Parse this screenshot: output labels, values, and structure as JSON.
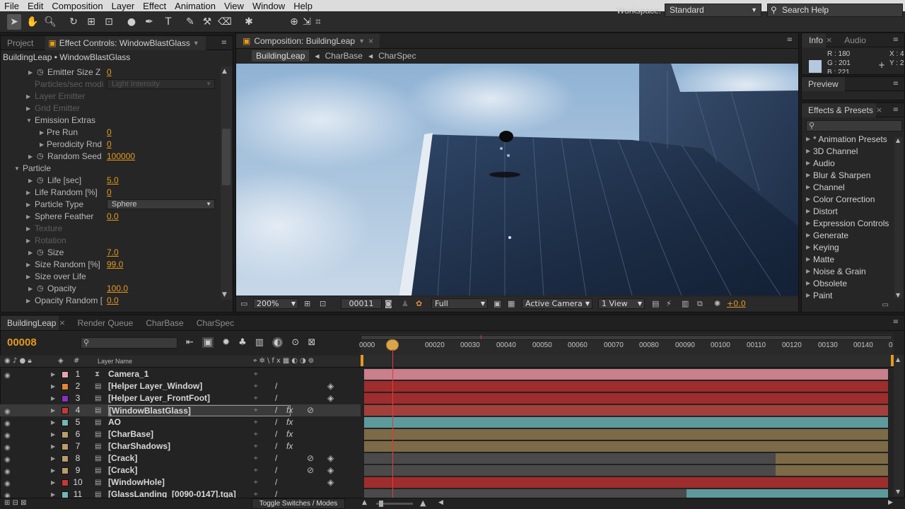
{
  "menu": [
    "File",
    "Edit",
    "Composition",
    "Layer",
    "Effect",
    "Animation",
    "View",
    "Window",
    "Help"
  ],
  "workspace": {
    "label": "Workspace:",
    "value": "Standard"
  },
  "search_help": "Search Help",
  "left_panel": {
    "tab_project": "Project",
    "tab_effect": "Effect Controls: WindowBlastGlass",
    "title": "BuildingLeap • WindowBlastGlass",
    "props": [
      {
        "name": "Emitter Size Z",
        "val": "0",
        "indent": 2,
        "stopwatch": true
      },
      {
        "name": "Particles/sec modi",
        "dd": "Light Intensity",
        "indent": 2,
        "dim": true
      },
      {
        "name": "Layer Emitter",
        "indent": 1,
        "dim": true
      },
      {
        "name": "Grid Emitter",
        "indent": 1,
        "dim": true
      },
      {
        "name": "Emission Extras",
        "indent": 1,
        "open": true
      },
      {
        "name": "Pre Run",
        "val": "0",
        "indent": 2
      },
      {
        "name": "Perodicity Rnd",
        "val": "0",
        "indent": 2
      },
      {
        "name": "Random Seed",
        "val": "100000",
        "indent": 2,
        "stopwatch": true
      },
      {
        "name": "Particle",
        "indent": 0,
        "open": true
      },
      {
        "name": "Life [sec]",
        "val": "5.0",
        "indent": 2,
        "stopwatch": true
      },
      {
        "name": "Life Random [%]",
        "val": "0",
        "indent": 1
      },
      {
        "name": "Particle Type",
        "dd": "Sphere",
        "indent": 1
      },
      {
        "name": "Sphere Feather",
        "val": "0.0",
        "indent": 1
      },
      {
        "name": "Texture",
        "indent": 1,
        "dim": true
      },
      {
        "name": "Rotation",
        "indent": 1,
        "dim": true
      },
      {
        "name": "Size",
        "val": "7.0",
        "indent": 2,
        "stopwatch": true
      },
      {
        "name": "Size Random [%]",
        "val": "99.0",
        "indent": 1
      },
      {
        "name": "Size over Life",
        "indent": 1
      },
      {
        "name": "Opacity",
        "val": "100.0",
        "indent": 2,
        "stopwatch": true
      },
      {
        "name": "Opacity Random [",
        "val": "0.0",
        "indent": 1
      }
    ]
  },
  "comp": {
    "tab": "Composition: BuildingLeap",
    "crumbs": [
      "BuildingLeap",
      "CharBase",
      "CharSpec"
    ],
    "zoom": "200%",
    "frame": "00011",
    "resolution": "Full",
    "camera": "Active Camera",
    "views": "1 View",
    "exposure": "+0.0"
  },
  "right": {
    "tab_info": "Info",
    "tab_audio": "Audio",
    "r": "R : 180",
    "g": "G : 201",
    "b": "B : 221",
    "x": "X : 4",
    "y": "Y : 2",
    "preview": "Preview",
    "effects_tab": "Effects & Presets",
    "effects": [
      "* Animation Presets",
      "3D Channel",
      "Audio",
      "Blur & Sharpen",
      "Channel",
      "Color Correction",
      "Distort",
      "Expression Controls",
      "Generate",
      "Keying",
      "Matte",
      "Noise & Grain",
      "Obsolete",
      "Paint"
    ]
  },
  "timeline": {
    "tabs": [
      "BuildingLeap",
      "Render Queue",
      "CharBase",
      "CharSpec"
    ],
    "current": "00008",
    "col_layer": "Layer Name",
    "col_num": "#",
    "toggle": "Toggle Switches / Modes",
    "ruler": [
      "0000",
      "00020",
      "00030",
      "00040",
      "00050",
      "00060",
      "00070",
      "00080",
      "00090",
      "00100",
      "00110",
      "00120",
      "00130",
      "00140",
      "0"
    ],
    "layers": [
      {
        "num": "1",
        "name": "Camera_1",
        "color": "#e7a4b0",
        "bar": "#c97f8c",
        "start": 0,
        "end": 1
      },
      {
        "num": "2",
        "name": "[Helper Layer_Window]",
        "color": "#e38436",
        "bar": "#9e2d2d",
        "start": 0,
        "end": 1
      },
      {
        "num": "3",
        "name": "[Helper Layer_FrontFoot]",
        "color": "#8b2fc0",
        "bar": "#9e2d2d",
        "start": 0,
        "end": 1
      },
      {
        "num": "4",
        "name": "[WindowBlastGlass]",
        "color": "#c23a3a",
        "bar": "#a3403c",
        "start": 0,
        "end": 1,
        "selected": true
      },
      {
        "num": "5",
        "name": "AO",
        "color": "#75b5b8",
        "bar": "#5d9a9c",
        "start": 0,
        "end": 1
      },
      {
        "num": "6",
        "name": "[CharBase]",
        "color": "#b79d6b",
        "bar": "#7d6a46",
        "start": 0,
        "end": 1
      },
      {
        "num": "7",
        "name": "[CharShadows]",
        "color": "#b79d6b",
        "bar": "#7d6a46",
        "start": 0,
        "end": 1
      },
      {
        "num": "8",
        "name": "[Crack]",
        "color": "#b79d6b",
        "bar": "#7d6a46",
        "start": 0.785,
        "end": 1
      },
      {
        "num": "9",
        "name": "[Crack]",
        "color": "#b79d6b",
        "bar": "#7d6a46",
        "start": 0.785,
        "end": 1
      },
      {
        "num": "10",
        "name": "[WindowHole]",
        "color": "#c23a3a",
        "bar": "#9e2d2d",
        "start": 0,
        "end": 1
      },
      {
        "num": "11",
        "name": "[GlassLanding_[0090-0147].tga]",
        "color": "#75b5b8",
        "bar": "#5d9a9c",
        "start": 0.615,
        "end": 1
      }
    ]
  }
}
